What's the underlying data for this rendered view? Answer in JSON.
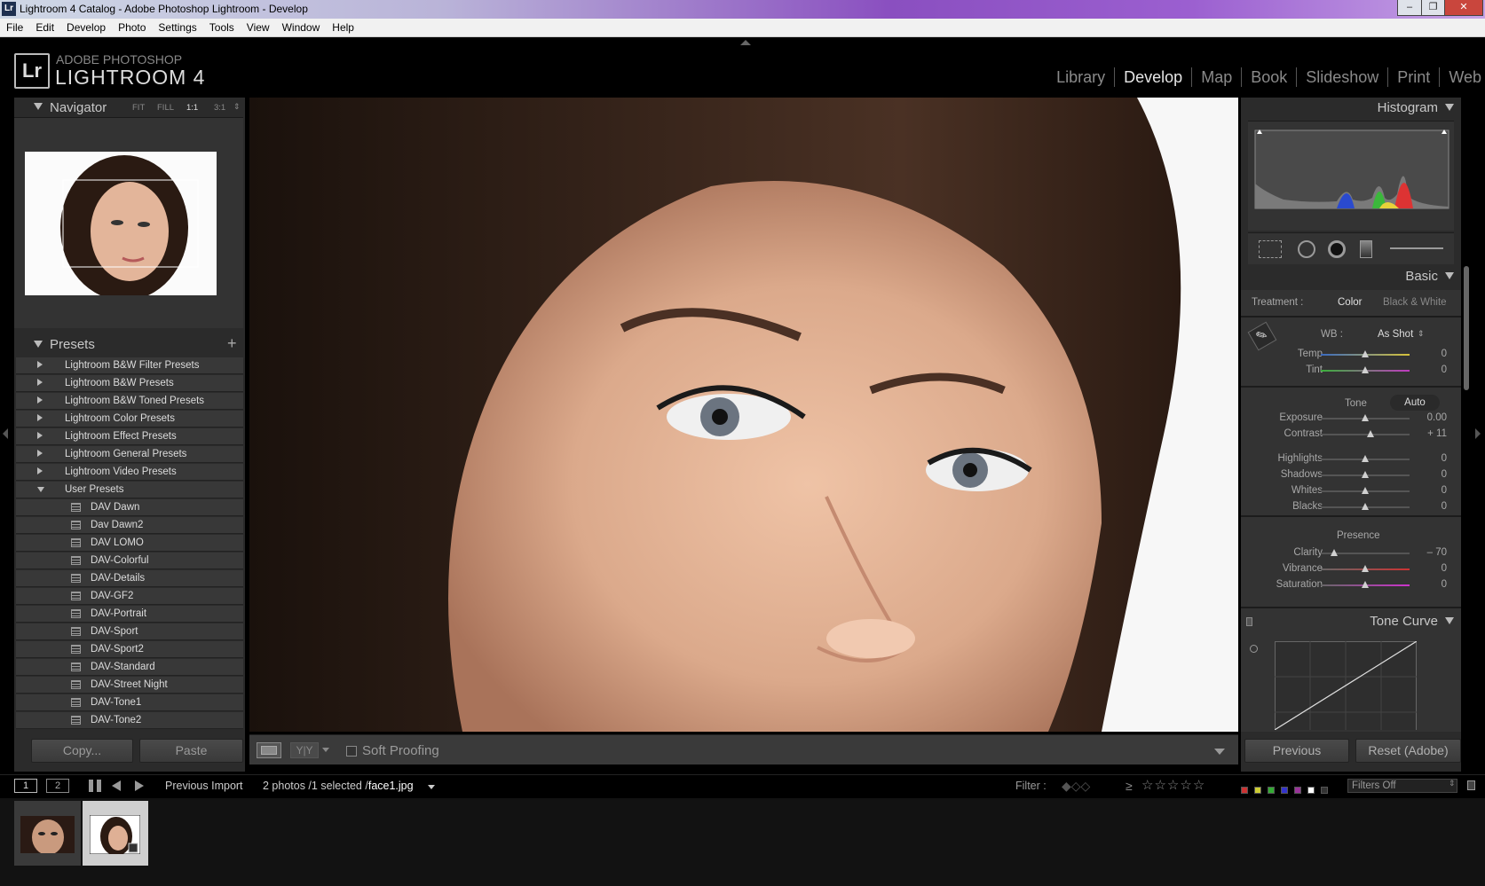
{
  "window": {
    "title": "Lightroom 4 Catalog - Adobe Photoshop Lightroom - Develop",
    "app_badge": "Lr"
  },
  "menu": [
    "File",
    "Edit",
    "Develop",
    "Photo",
    "Settings",
    "Tools",
    "View",
    "Window",
    "Help"
  ],
  "identity": {
    "badge": "Lr",
    "line1": "ADOBE PHOTOSHOP",
    "line2": "LIGHTROOM 4"
  },
  "modules": [
    "Library",
    "Develop",
    "Map",
    "Book",
    "Slideshow",
    "Print",
    "Web"
  ],
  "active_module": "Develop",
  "navigator": {
    "title": "Navigator",
    "zoom_options": [
      "FIT",
      "FILL",
      "1:1",
      "3:1"
    ],
    "selected_zoom": "1:1"
  },
  "presets": {
    "title": "Presets",
    "add_icon": "plus-icon",
    "folders": [
      "Lightroom B&W Filter Presets",
      "Lightroom B&W Presets",
      "Lightroom B&W Toned Presets",
      "Lightroom Color Presets",
      "Lightroom Effect Presets",
      "Lightroom General Presets",
      "Lightroom Video Presets"
    ],
    "user_folder": "User Presets",
    "user_items": [
      "DAV Dawn",
      "Dav Dawn2",
      "DAV LOMO",
      "DAV-Colorful",
      "DAV-Details",
      "DAV-GF2",
      "DAV-Portrait",
      "DAV-Sport",
      "DAV-Sport2",
      "DAV-Standard",
      "DAV-Street Night",
      "DAV-Tone1",
      "DAV-Tone2"
    ]
  },
  "left_buttons": {
    "copy": "Copy...",
    "paste": "Paste"
  },
  "toolbar": {
    "soft_proofing": "Soft Proofing"
  },
  "histogram": {
    "title": "Histogram"
  },
  "basic": {
    "title": "Basic",
    "treatment_label": "Treatment :",
    "treatment_color": "Color",
    "treatment_bw": "Black & White",
    "wb_label": "WB :",
    "wb_value": "As Shot",
    "tone_label": "Tone",
    "auto_label": "Auto",
    "presence_label": "Presence",
    "wb_sliders": [
      {
        "name": "Temp",
        "value": "0",
        "level": 0.5
      },
      {
        "name": "Tint",
        "value": "0",
        "level": 0.5
      }
    ],
    "tone_sliders": [
      {
        "name": "Exposure",
        "value": "0.00",
        "level": 0.5
      },
      {
        "name": "Contrast",
        "value": "+ 11",
        "level": 0.555
      }
    ],
    "tone_sliders2": [
      {
        "name": "Highlights",
        "value": "0",
        "level": 0.5
      },
      {
        "name": "Shadows",
        "value": "0",
        "level": 0.5
      },
      {
        "name": "Whites",
        "value": "0",
        "level": 0.5
      },
      {
        "name": "Blacks",
        "value": "0",
        "level": 0.5
      }
    ],
    "presence_sliders": [
      {
        "name": "Clarity",
        "value": "– 70",
        "level": 0.15
      },
      {
        "name": "Vibrance",
        "value": "0",
        "level": 0.5
      },
      {
        "name": "Saturation",
        "value": "0",
        "level": 0.5
      }
    ]
  },
  "tone_curve": {
    "title": "Tone Curve"
  },
  "right_buttons": {
    "previous": "Previous",
    "reset": "Reset (Adobe)"
  },
  "filmstrip_bar": {
    "page1": "1",
    "page2": "2",
    "source": "Previous Import",
    "selection": "2 photos /1 selected /",
    "filename": "face1.jpg",
    "filter_label": "Filter :",
    "filter_value": "Filters Off",
    "rating_op": "≥"
  },
  "colors": {
    "panel_bg": "#2b2b2b",
    "panel_header": "#c8c8c8",
    "active_module": "#e6e6e6",
    "inactive_module": "#8a8a8a"
  }
}
